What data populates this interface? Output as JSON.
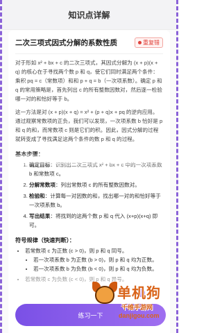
{
  "header": {
    "title": "知识点详解"
  },
  "card": {
    "title": "二次三项式因式分解的系数性质",
    "tag": "重复错",
    "intro": "对于形如 x² + bx + c 的二次三项式，其因式分解为 (x + p)(x + q) 的核心在于寻找两个数 p 和 q，使它们同时满足两个条件：乘积 pq = c（常数项）和和 p + q = b（一次项系数）。确定 p 和 q 的常用策略是，首先列出 c 的所有整数因数对，然后逐一检验哪一对的和恰好等于 b。",
    "para2": "这一方法是对 (x + p)(x + q) = x² + (p + q)x + pq 的逆向应用。通过观察常数项的正负，我们可以发现，一次项系数 b 恰好是 p 和 q 的和，而常数项 c 则是它们的积。因此，因式分解的过程就转变成了寻找满足这两个条件的数 p 和 q 的过程。",
    "steps_title": "基本步骤：",
    "steps": [
      {
        "label": "确定目标",
        "text": "：识别出二次三项式 x² + bx + c 中的一次项系数 b 和常数项 c。"
      },
      {
        "label": "分解常数项",
        "text": "：列出常数项 c 的所有整数因数对。"
      },
      {
        "label": "检验和",
        "text": "：计算每一对因数的和，找出哪一对的和恰好等于一次项系数 b。"
      },
      {
        "label": "写出结果",
        "text": "：将找到的这两个数 p 和 q 代入 (x+p)(x+q) 即可。"
      }
    ],
    "rules_title": "符号规律（快速判断）：",
    "rules": [
      {
        "text": "若常数项 c 为正数 (c > 0)，则 p 和 q 同号。",
        "sub": [
          "若一次项系数 b 为正数 (b > 0)，则 p 和 q 均为正数。",
          "若一次项系数 b 为负数 (b < 0)，则 p 和 q 均为负数。"
        ]
      },
      {
        "text": "若常数项 c 为负数 (c < 0)，则 p 和 q 异号。",
        "sub": []
      }
    ]
  },
  "footer": {
    "button_label": "练习一下"
  },
  "watermark": {
    "brand": "单机狗",
    "sub": "千维手游网",
    "url": "danjigou.com"
  },
  "colors": {
    "accent": "#8a62d8",
    "tag_red": "#e0413a",
    "watermark": "#d9641a"
  }
}
